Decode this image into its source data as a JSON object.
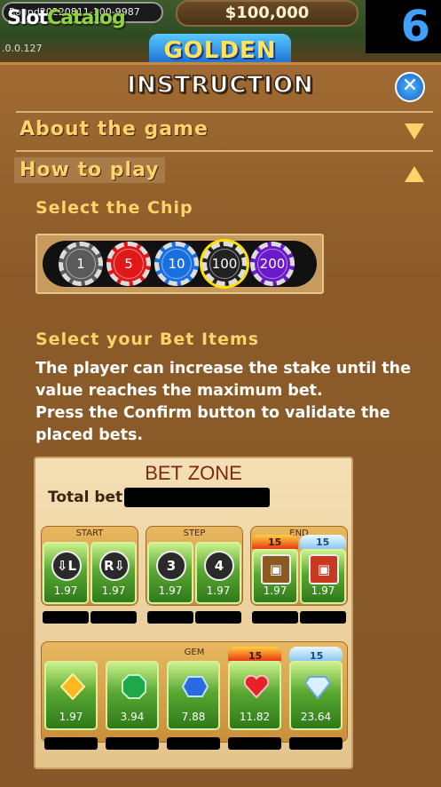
{
  "top": {
    "round_label": "Round20220811-100-9987",
    "watermark_slot": "Slot",
    "watermark_catalog": "Catalog",
    "version": ".0.0.127",
    "balance": "$100,000",
    "logo_text": "GOLDEN",
    "level": "6"
  },
  "panel": {
    "title": "INSTRUCTION",
    "close_icon": "close-icon",
    "sections": {
      "about": "About the game",
      "howto": "How to play"
    },
    "select_chip_heading": "Select the Chip",
    "chips": [
      {
        "label": "1",
        "color": "#5a5a5a"
      },
      {
        "label": "5",
        "color": "#e01818"
      },
      {
        "label": "10",
        "color": "#1a6fe0"
      },
      {
        "label": "100",
        "color": "#222222"
      },
      {
        "label": "200",
        "color": "#6a18c8"
      }
    ],
    "selected_chip": "100",
    "bet_items_heading": "Select your Bet Items",
    "paragraph1": "The player can increase the stake until the value reaches the maximum bet.",
    "paragraph2": "Press the Confirm button to validate the placed bets."
  },
  "betzone": {
    "title": "BET ZONE",
    "total_label": "Total bet",
    "groups": {
      "start": "START",
      "step": "STEP",
      "end": "END",
      "gem": "GEM"
    },
    "start_tiles": [
      {
        "icon": "⇩L",
        "odds": "1.97"
      },
      {
        "icon": "R⇩",
        "odds": "1.97"
      }
    ],
    "step_tiles": [
      {
        "icon": "3",
        "odds": "1.97"
      },
      {
        "icon": "4",
        "odds": "1.97"
      }
    ],
    "end_tiles": [
      {
        "badge": "15",
        "odds": "1.97"
      },
      {
        "badge": "15",
        "odds": "1.97"
      }
    ],
    "gem_tiles": [
      {
        "gem": "yellow-diamond-icon",
        "odds": "1.97",
        "badge": ""
      },
      {
        "gem": "green-emerald-icon",
        "odds": "3.94",
        "badge": ""
      },
      {
        "gem": "blue-sapphire-icon",
        "odds": "7.88",
        "badge": ""
      },
      {
        "gem": "red-heart-icon",
        "odds": "11.82",
        "badge": "15"
      },
      {
        "gem": "white-diamond-icon",
        "odds": "23.64",
        "badge": "15"
      }
    ],
    "colors": {
      "tile_green": "#5aa832",
      "title_red": "#7a2a10"
    }
  }
}
